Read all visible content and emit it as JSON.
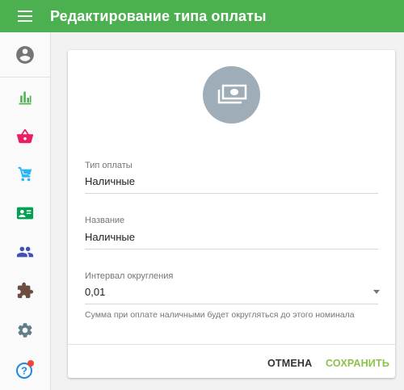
{
  "header": {
    "title": "Редактирование типа оплаты",
    "menu_icon": "menu-icon"
  },
  "sidebar": {
    "items": [
      {
        "icon": "account-circle-icon",
        "color": "#757575"
      },
      {
        "icon": "bar-chart-icon",
        "color": "#4caf50"
      },
      {
        "icon": "basket-icon",
        "color": "#e91e63"
      },
      {
        "icon": "cart-icon",
        "color": "#29b6f6"
      },
      {
        "icon": "contact-card-icon",
        "color": "#00a152"
      },
      {
        "icon": "people-icon",
        "color": "#3f51b5"
      },
      {
        "icon": "puzzle-icon",
        "color": "#6d4c41"
      },
      {
        "icon": "gear-icon",
        "color": "#607d8b"
      },
      {
        "icon": "help-icon",
        "color": "#1e88e5",
        "badge_color": "#f44336"
      }
    ]
  },
  "form": {
    "payment_type": {
      "label": "Тип оплаты",
      "value": "Наличные"
    },
    "name": {
      "label": "Название",
      "value": "Наличные"
    },
    "rounding": {
      "label": "Интервал округления",
      "value": "0,01",
      "hint": "Сумма при оплате наличными будет округляться до этого номинала"
    },
    "cancel_label": "ОТМЕНА",
    "save_label": "СОХРАНИТЬ"
  },
  "colors": {
    "accent": "#4caf50",
    "save": "#8bc34a",
    "avatar_bg": "#9eadb8"
  }
}
